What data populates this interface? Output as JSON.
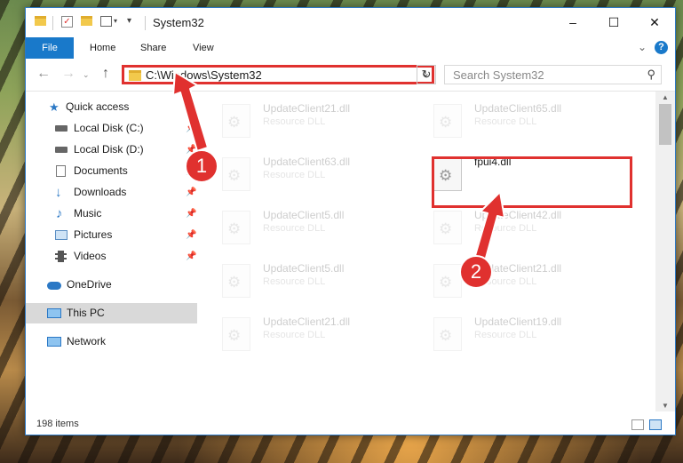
{
  "window": {
    "title": "System32",
    "minimize": "–",
    "maximize": "☐",
    "close": "✕"
  },
  "ribbon": {
    "tabs": [
      {
        "label": "File"
      },
      {
        "label": "Home"
      },
      {
        "label": "Share"
      },
      {
        "label": "View"
      }
    ],
    "help": "?"
  },
  "navigation": {
    "address": "C:\\Windows\\System32",
    "search_placeholder": "Search System32"
  },
  "sidebar": {
    "items": [
      {
        "label": "Quick access"
      },
      {
        "label": "Local Disk (C:)"
      },
      {
        "label": "Local Disk (D:)"
      },
      {
        "label": "Documents"
      },
      {
        "label": "Downloads"
      },
      {
        "label": "Music"
      },
      {
        "label": "Pictures"
      },
      {
        "label": "Videos"
      },
      {
        "label": "OneDrive"
      },
      {
        "label": "This PC"
      },
      {
        "label": "Network"
      }
    ]
  },
  "files": [
    {
      "name": "UpdateClient21.dll",
      "type": "Resource DLL"
    },
    {
      "name": "UpdateClient65.dll",
      "type": "Resource DLL"
    },
    {
      "name": "UpdateClient63.dll",
      "type": "Resource DLL"
    },
    {
      "name": "fpui4.dll",
      "type": ""
    },
    {
      "name": "UpdateClient5.dll",
      "type": "Resource DLL"
    },
    {
      "name": "UpdateClient42.dll",
      "type": "Resource DLL"
    },
    {
      "name": "UpdateClient5.dll",
      "type": "Resource DLL"
    },
    {
      "name": "UpdateClient21.dll",
      "type": "Resource DLL"
    },
    {
      "name": "UpdateClient21.dll",
      "type": "Resource DLL"
    },
    {
      "name": "UpdateClient19.dll",
      "type": "Resource DLL"
    }
  ],
  "status": {
    "item_count": "198 items"
  },
  "annotations": {
    "step1": "1",
    "step2": "2",
    "color": "#e0312f"
  }
}
